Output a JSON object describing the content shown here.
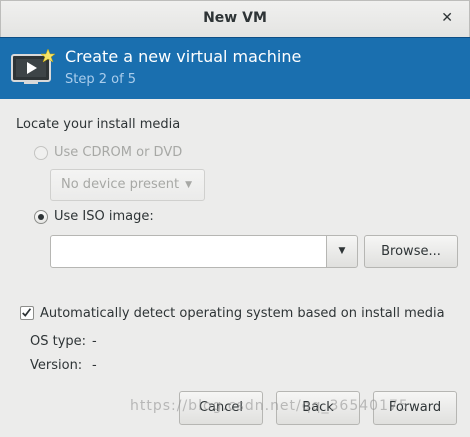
{
  "window": {
    "title": "New VM"
  },
  "banner": {
    "title": "Create a new virtual machine",
    "step": "Step 2 of 5"
  },
  "media": {
    "section_label": "Locate your install media",
    "cdrom_label": "Use CDROM or DVD",
    "device_placeholder": "No device present",
    "iso_label": "Use ISO image:",
    "iso_path": "",
    "browse_label": "Browse..."
  },
  "detect": {
    "label": "Automatically detect operating system based on install media",
    "checked": true,
    "os_type_label": "OS type:",
    "os_type_value": "-",
    "version_label": "Version:",
    "version_value": "-"
  },
  "buttons": {
    "cancel": "Cancel",
    "back": "Back",
    "forward": "Forward"
  },
  "watermark": "https://blog.csdn.net/qq_36540175"
}
